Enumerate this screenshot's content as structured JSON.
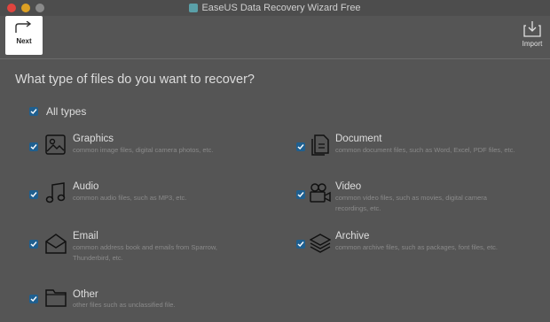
{
  "window": {
    "title": "EaseUS Data Recovery Wizard Free",
    "traffic_lights": [
      "#e0443e",
      "#dea123",
      "#8a8a8a"
    ]
  },
  "toolbar": {
    "next_label": "Next",
    "import_label": "Import"
  },
  "main": {
    "heading": "What type of files do you want to recover?",
    "all_types_label": "All types",
    "categories": [
      {
        "label": "Graphics",
        "desc": "common image files, digital camera photos, etc.",
        "icon": "image-icon",
        "checked": true
      },
      {
        "label": "Document",
        "desc": "common document files, such as Word, Excel, PDF files, etc.",
        "icon": "document-icon",
        "checked": true
      },
      {
        "label": "Audio",
        "desc": "common audio files, such as MP3, etc.",
        "icon": "music-note-icon",
        "checked": true
      },
      {
        "label": "Video",
        "desc": "common video files, such as movies, digital camera recordings, etc.",
        "icon": "video-camera-icon",
        "checked": true
      },
      {
        "label": "Email",
        "desc": "common address book and emails from Sparrow, Thunderbird, etc.",
        "icon": "envelope-icon",
        "checked": true
      },
      {
        "label": "Archive",
        "desc": "common archive files, such as packages, font files, etc.",
        "icon": "layers-icon",
        "checked": true
      },
      {
        "label": "Other",
        "desc": "other files such as unclassified file.",
        "icon": "folder-icon",
        "checked": true
      }
    ]
  },
  "colors": {
    "checkbox": "#1f5f8f",
    "background": "#555555"
  }
}
